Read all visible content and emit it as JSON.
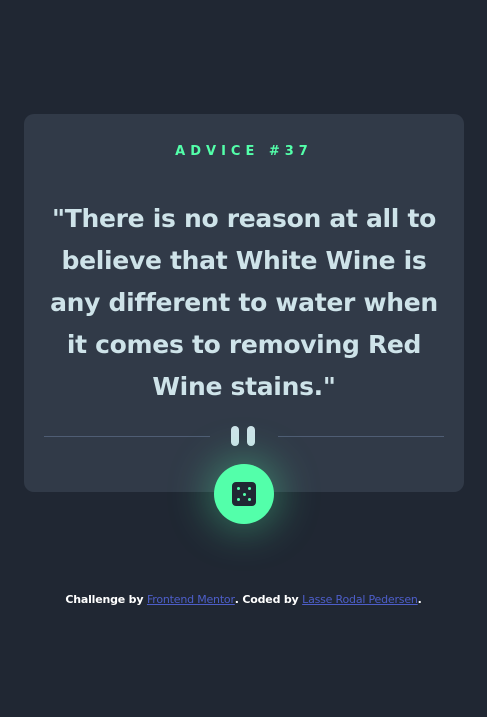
{
  "advice": {
    "label": "ADVICE #37",
    "quote": "\"There is no reason at all to believe that White Wine is any different to water when it comes to removing Red Wine stains.\""
  },
  "icons": {
    "divider": "pause-icon",
    "button": "dice-icon"
  },
  "footer": {
    "prefix": "Challenge by ",
    "link1": "Frontend Mentor",
    "middle": ". Coded by ",
    "link2": "Lasse Rodal Pedersen",
    "suffix": "."
  },
  "colors": {
    "background": "#202733",
    "card": "#313a48",
    "accent": "#53ffaa",
    "text": "#cee3e9",
    "link": "#4d5ec9"
  }
}
